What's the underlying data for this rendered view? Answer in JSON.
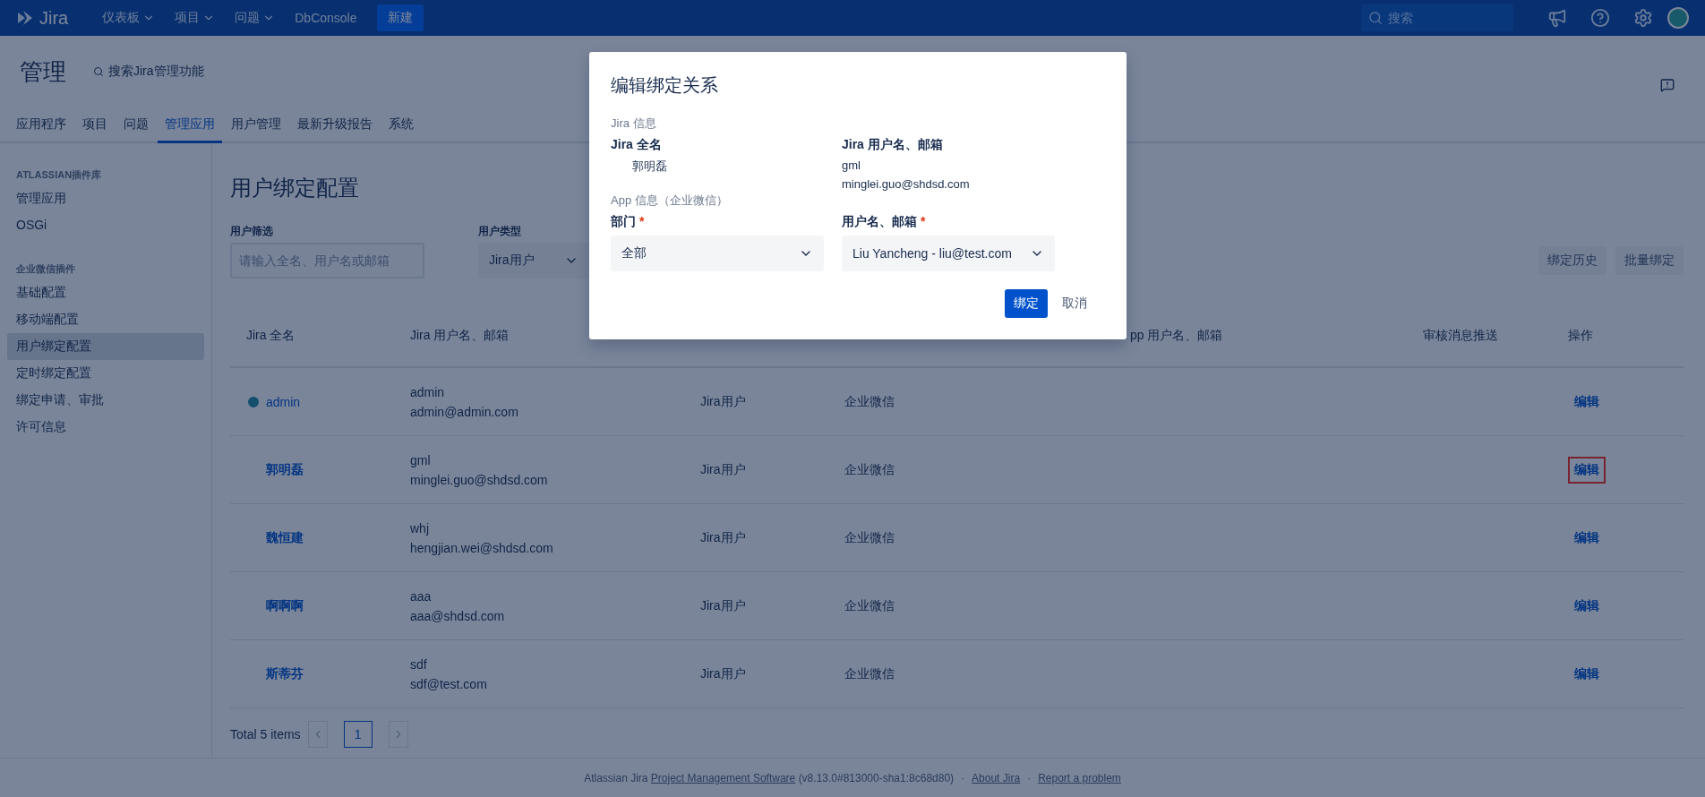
{
  "topbar": {
    "logo": "Jira",
    "menu": [
      {
        "label": "仪表板",
        "dropdown": true
      },
      {
        "label": "项目",
        "dropdown": true
      },
      {
        "label": "问题",
        "dropdown": true
      },
      {
        "label": "DbConsole",
        "dropdown": false
      }
    ],
    "create": "新建",
    "search": {
      "placeholder": "搜索"
    }
  },
  "header": {
    "title": "管理",
    "search_link": "搜索Jira管理功能"
  },
  "tabs": [
    {
      "label": "应用程序",
      "selected": false
    },
    {
      "label": "项目",
      "selected": false
    },
    {
      "label": "问题",
      "selected": false
    },
    {
      "label": "管理应用",
      "selected": true
    },
    {
      "label": "用户管理",
      "selected": false
    },
    {
      "label": "最新升级报告",
      "selected": false
    },
    {
      "label": "系统",
      "selected": false
    }
  ],
  "sidebar": {
    "groups": [
      {
        "heading": "ATLASSIAN插件库",
        "items": [
          {
            "label": "管理应用",
            "selected": false
          },
          {
            "label": "OSGi",
            "selected": false
          }
        ]
      },
      {
        "heading": "企业微信插件",
        "items": [
          {
            "label": "基础配置",
            "selected": false
          },
          {
            "label": "移动端配置",
            "selected": false
          },
          {
            "label": "用户绑定配置",
            "selected": true
          },
          {
            "label": "定时绑定配置",
            "selected": false
          },
          {
            "label": "绑定申请、审批",
            "selected": false
          },
          {
            "label": "许可信息",
            "selected": false
          }
        ]
      }
    ]
  },
  "page_title": "用户绑定配置",
  "filters": {
    "user_filter": {
      "label": "用户筛选",
      "placeholder": "请输入全名、用户名或邮箱"
    },
    "user_type": {
      "label": "用户类型",
      "value": "Jira用户"
    }
  },
  "actions": [
    "绑定历史",
    "批量绑定"
  ],
  "table": {
    "columns": [
      {
        "label": "Jira 全名"
      },
      {
        "label": "Jira 用户名、邮箱"
      },
      {},
      {},
      {
        "label": "pp 用户名、邮箱"
      },
      {
        "label": "审核消息推送"
      },
      {
        "label": "操作"
      }
    ],
    "rows": [
      {
        "name": "admin",
        "avatar": true,
        "username": "admin",
        "email": "admin@admin.com",
        "user_type": "Jira用户",
        "app": "企业微信",
        "action": "编辑",
        "highlighted": false
      },
      {
        "name": "郭明磊",
        "avatar": false,
        "username": "gml",
        "email": "minglei.guo@shdsd.com",
        "user_type": "Jira用户",
        "app": "企业微信",
        "action": "编辑",
        "highlighted": true
      },
      {
        "name": "魏恒建",
        "avatar": false,
        "username": "whj",
        "email": "hengjian.wei@shdsd.com",
        "user_type": "Jira用户",
        "app": "企业微信",
        "action": "编辑",
        "highlighted": false
      },
      {
        "name": "啊啊啊",
        "avatar": false,
        "username": "aaa",
        "email": "aaa@shdsd.com",
        "user_type": "Jira用户",
        "app": "企业微信",
        "action": "编辑",
        "highlighted": false
      },
      {
        "name": "斯蒂芬",
        "avatar": false,
        "username": "sdf",
        "email": "sdf@test.com",
        "user_type": "Jira用户",
        "app": "企业微信",
        "action": "编辑",
        "highlighted": false
      }
    ]
  },
  "pagination": {
    "total": "Total 5 items",
    "pages": [
      {
        "label": "1",
        "selected": true
      }
    ]
  },
  "footer": {
    "prefix": "Atlassian Jira",
    "product_link": "Project Management Software",
    "version": "(v8.13.0#813000-sha1:8c68d80)",
    "separator": "·",
    "links": [
      "About Jira",
      "Report a problem"
    ]
  },
  "dialog": {
    "title": "编辑绑定关系",
    "jira_section": "Jira 信息",
    "fullname_label": "Jira 全名",
    "fullname": "郭明磊",
    "username_label": "Jira 用户名、邮箱",
    "username": "gml",
    "email": "minglei.guo@shdsd.com",
    "app_section": "App 信息（企业微信）",
    "department": {
      "label": "部门",
      "required_mark": "*",
      "value": "全部"
    },
    "app_user": {
      "label": "用户名、邮箱",
      "required_mark": "*",
      "value": "Liu Yancheng - liu@test.com"
    },
    "buttons": [
      {
        "label": "绑定",
        "kind": "primary"
      },
      {
        "label": "取消",
        "kind": "link"
      }
    ]
  }
}
